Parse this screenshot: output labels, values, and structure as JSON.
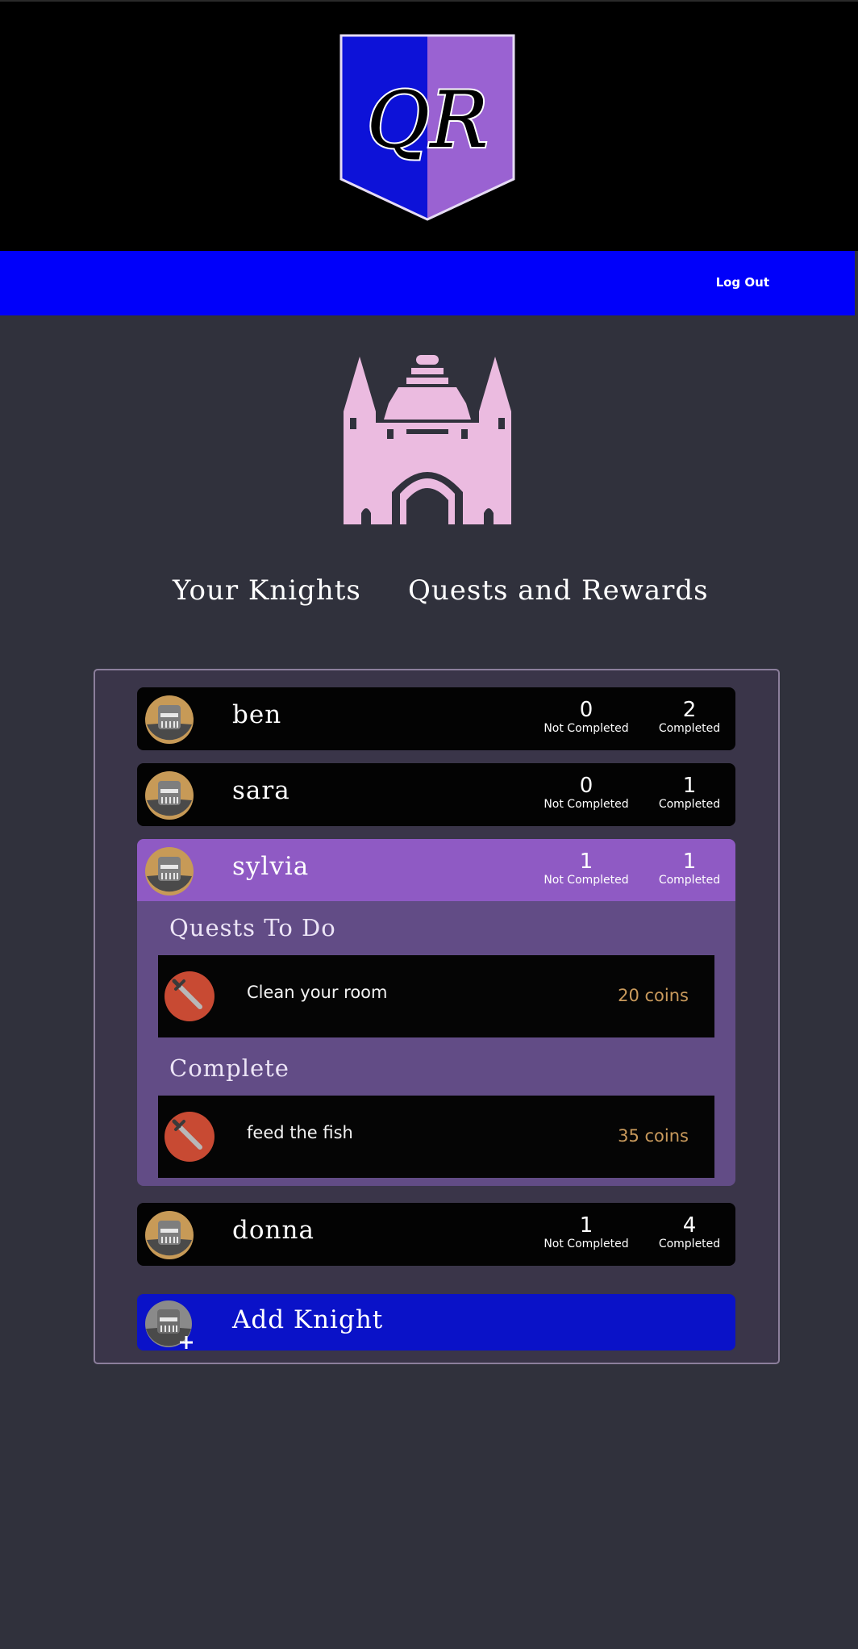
{
  "header": {
    "logo_text": "QR",
    "logout_label": "Log Out"
  },
  "colors": {
    "nav_bar": "#0000fa",
    "active_knight": "#8f5ac4",
    "expanded_panel": "#624c86",
    "reward_coins": "#c99a5c",
    "add_knight": "#0a12c8",
    "castle": "#ebbbe0"
  },
  "tabs": [
    {
      "label": "Your Knights"
    },
    {
      "label": "Quests and Rewards"
    }
  ],
  "labels": {
    "not_completed": "Not Completed",
    "completed": "Completed"
  },
  "knights": [
    {
      "name": "ben",
      "not_completed": "0",
      "completed": "2",
      "icon": "knight-helmet-icon"
    },
    {
      "name": "sara",
      "not_completed": "0",
      "completed": "1",
      "icon": "knight-helmet-icon"
    },
    {
      "name": "sylvia",
      "not_completed": "1",
      "completed": "1",
      "icon": "knight-helmet-icon",
      "expanded": true
    },
    {
      "name": "donna",
      "not_completed": "1",
      "completed": "4",
      "icon": "knight-helmet-icon"
    }
  ],
  "expanded": {
    "todo_title": "Quests To Do",
    "complete_title": "Complete",
    "todo_quests": [
      {
        "name": "Clean your room",
        "reward": "20 coins",
        "icon": "sword-icon"
      }
    ],
    "complete_quests": [
      {
        "name": "feed the fish",
        "reward": "35 coins",
        "icon": "sword-icon"
      }
    ]
  },
  "add_knight": {
    "label": "Add Knight",
    "icon": "add-knight-icon"
  }
}
